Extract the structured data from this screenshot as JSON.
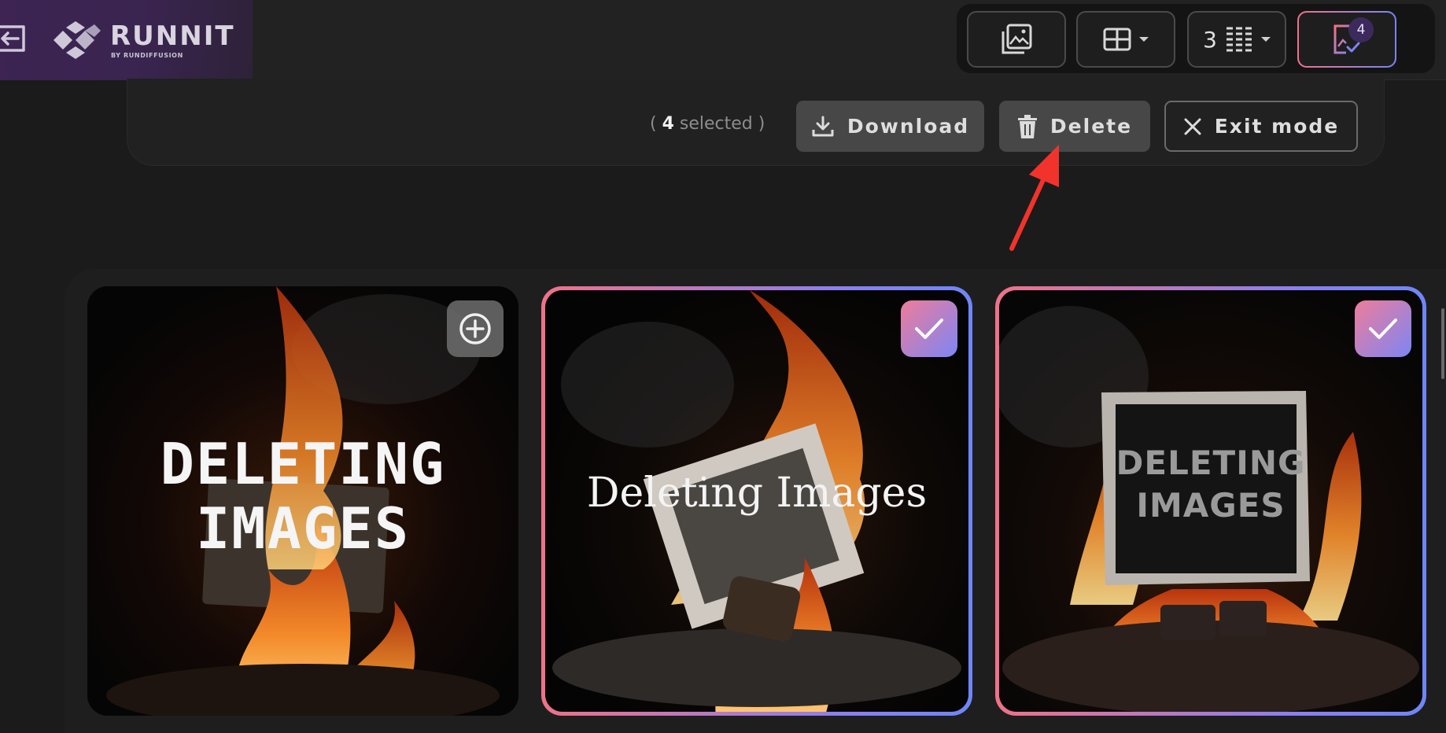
{
  "brand": {
    "name": "RUNNIT",
    "tagline": "BY RUNDIFFUSION"
  },
  "toolbar": {
    "columns_count": "3",
    "selected_badge": "4",
    "icons": [
      "gallery-icon",
      "grid-layout-icon",
      "columns-icon",
      "select-mode-icon"
    ]
  },
  "selection": {
    "open_paren": "(",
    "count": "4",
    "label": " selected",
    "close_paren": ")",
    "download_label": "Download",
    "delete_label": "Delete",
    "exit_label": "Exit mode"
  },
  "cards": [
    {
      "line1": "DELETING",
      "line2": "IMAGES",
      "selected": false
    },
    {
      "text": "Deleting Images",
      "selected": true
    },
    {
      "line1": "DELETING",
      "line2": "IMAGES",
      "selected": true
    }
  ],
  "colors": {
    "accent_pink": "#ef7288",
    "accent_blue": "#6f86f6",
    "annotation_red": "#f2332b"
  }
}
